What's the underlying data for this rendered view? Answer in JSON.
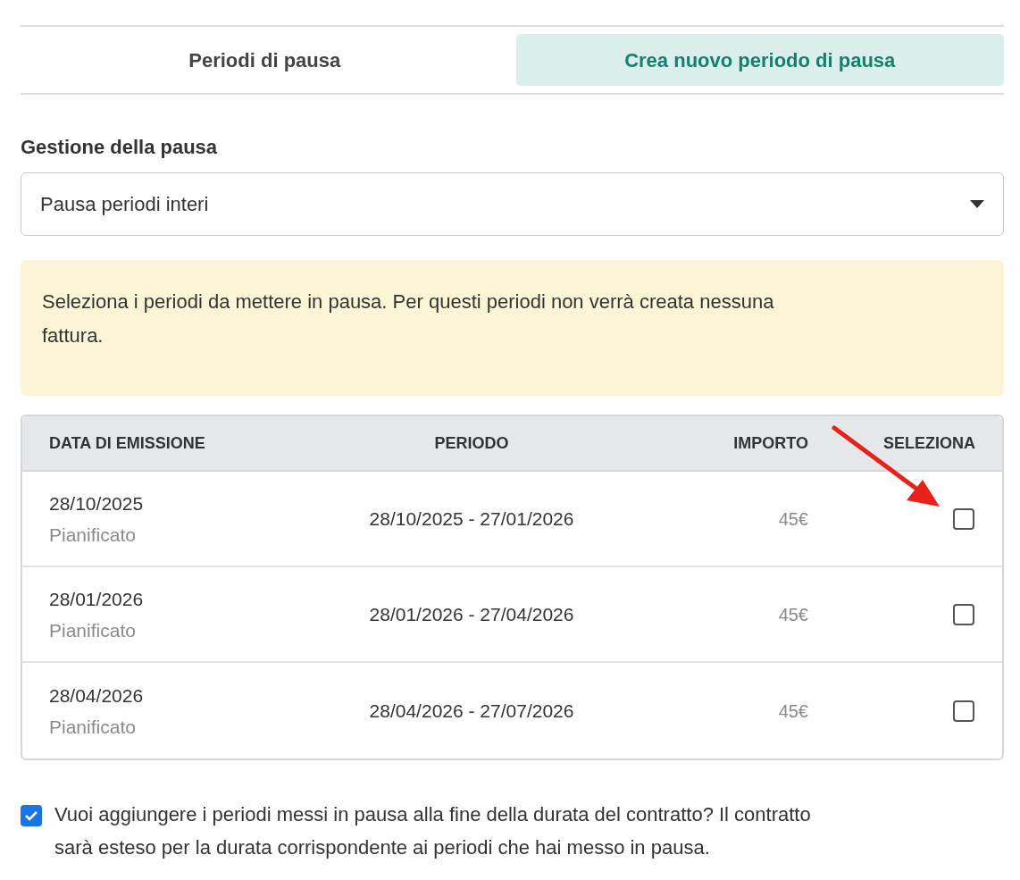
{
  "tabs": [
    {
      "label": "Periodi di pausa",
      "selected": false
    },
    {
      "label": "Crea nuovo periodo di pausa",
      "selected": true
    }
  ],
  "pause_management": {
    "label": "Gestione della pausa",
    "value": "Pausa periodi interi"
  },
  "notice": "Seleziona i periodi da mettere in pausa. Per questi periodi non verrà creata nessuna fattura.",
  "table": {
    "columns": [
      "DATA DI EMISSIONE",
      "PERIODO",
      "IMPORTO",
      "SELEZIONA"
    ],
    "rows": [
      {
        "issue_date": "28/10/2025",
        "status": "Pianificato",
        "period": "28/10/2025 - 27/01/2026",
        "amount": "45€",
        "selected": false
      },
      {
        "issue_date": "28/01/2026",
        "status": "Pianificato",
        "period": "28/01/2026 - 27/04/2026",
        "amount": "45€",
        "selected": false
      },
      {
        "issue_date": "28/04/2026",
        "status": "Pianificato",
        "period": "28/04/2026 - 27/07/2026",
        "amount": "45€",
        "selected": false
      }
    ]
  },
  "extend_option": {
    "checked": true,
    "text": "Vuoi aggiungere i periodi messi in pausa alla fine della durata del contratto? Il contratto sarà esteso per la durata corrispondente ai periodi che hai messo in pausa."
  }
}
